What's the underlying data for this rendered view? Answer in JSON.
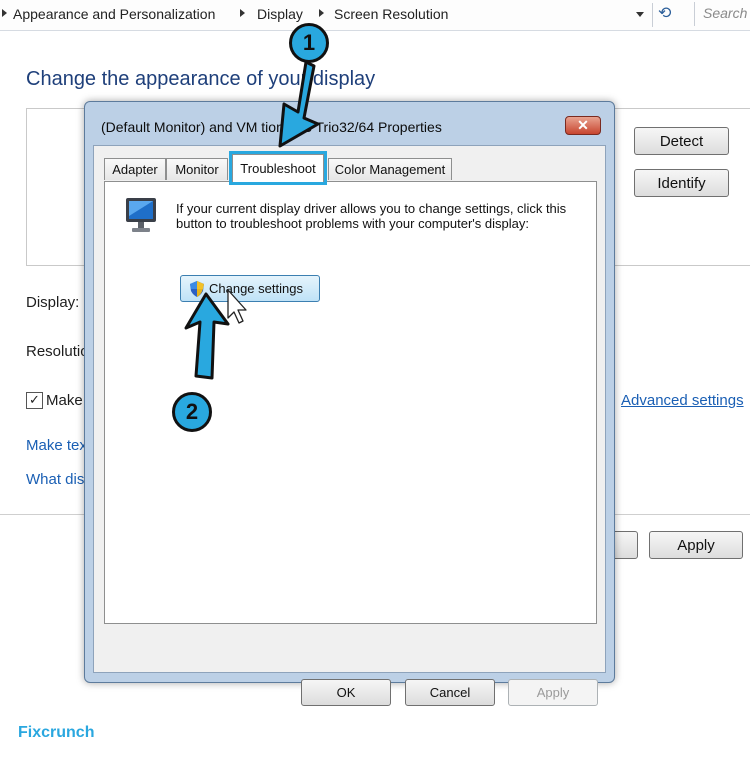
{
  "address_bar": {
    "breadcrumbs": [
      "Appearance and Personalization",
      "Display",
      "Screen Resolution"
    ],
    "search_placeholder": "Search"
  },
  "background_window": {
    "title": "Change the appearance of your display",
    "detect_label": "Detect",
    "identify_label": "Identify",
    "display_label": "Display:",
    "resolution_label": "Resolution",
    "make_label": "Make",
    "checkbox_mark": "✓",
    "advanced_link": "Advanced settings",
    "link_text_size": "Make tex",
    "link_what": "What dis",
    "apply_label": "Apply"
  },
  "dialog": {
    "title": "(Default Monitor) and VM          tions S3 Trio32/64 Properties",
    "close_glyph": "✕",
    "tabs": [
      {
        "label": "Adapter",
        "active": false
      },
      {
        "label": "Monitor",
        "active": false
      },
      {
        "label": "Troubleshoot",
        "active": true
      },
      {
        "label": "Color Management",
        "active": false
      }
    ],
    "description": "If your current display driver allows you to change settings, click this button to troubleshoot problems with your computer's display:",
    "change_settings_label": "Change settings",
    "ok_label": "OK",
    "cancel_label": "Cancel",
    "apply_label": "Apply"
  },
  "annotations": {
    "step1": "1",
    "step2": "2",
    "accent_color": "#29a8df"
  },
  "watermark": {
    "text": "Fixcrunch"
  }
}
